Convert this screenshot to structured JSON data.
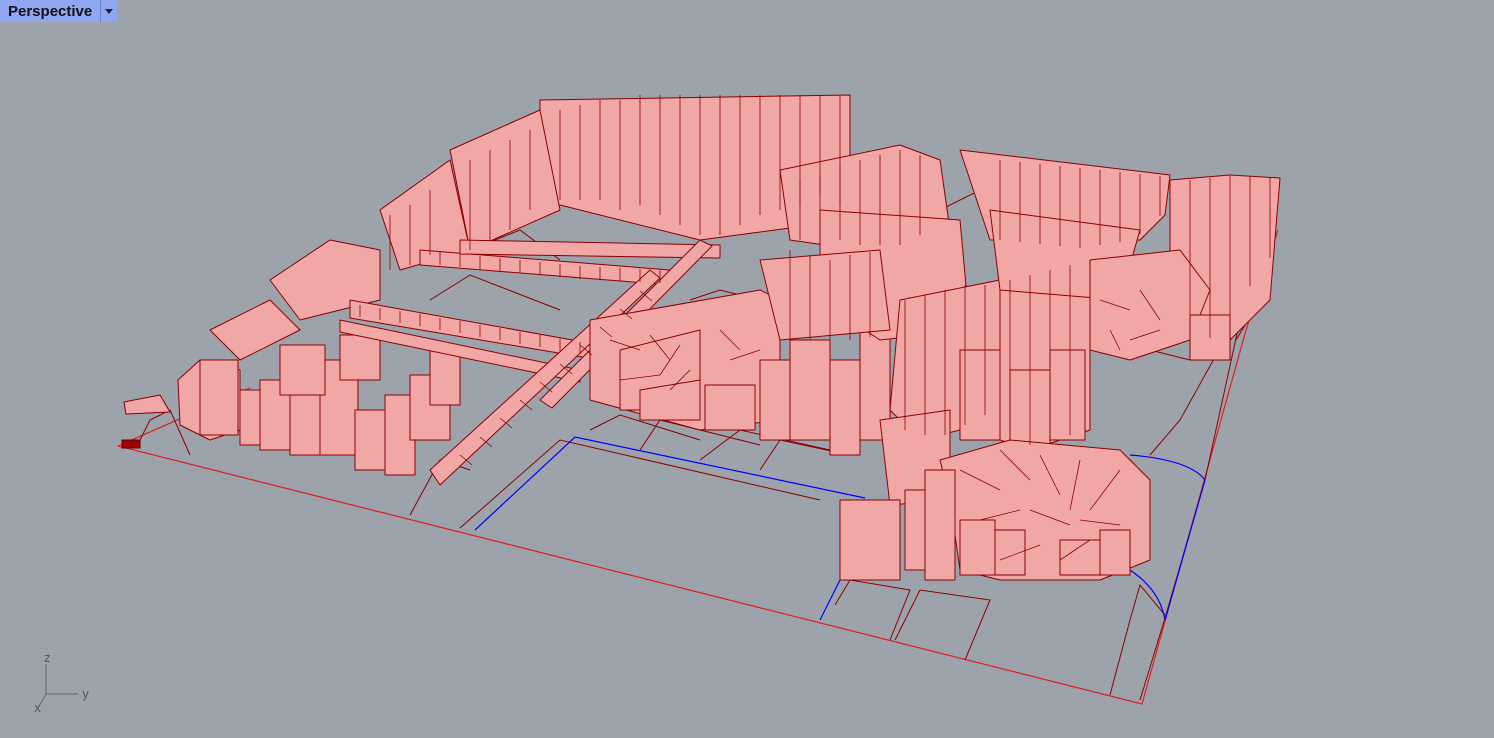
{
  "viewport": {
    "title": "Perspective",
    "menu_icon": "chevron-down-icon"
  },
  "axes": {
    "x": "x",
    "y": "y",
    "z": "z"
  },
  "colors": {
    "background": "#9ca3ab",
    "building_fill": "#f2a7a7",
    "building_edge": "#8b0000",
    "curve_selected": "#0000ff",
    "boundary": "#e02020"
  }
}
